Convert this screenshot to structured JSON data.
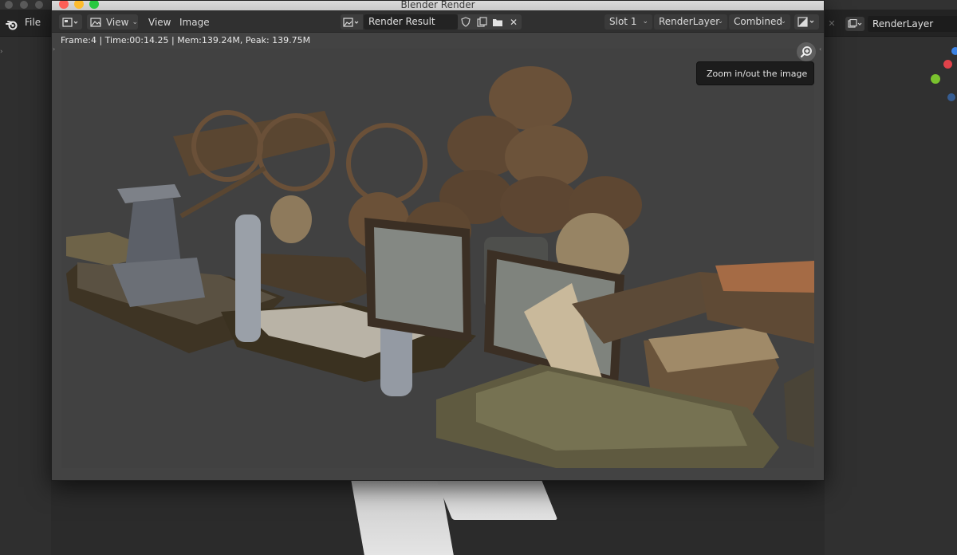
{
  "main_window": {
    "menu_file": "File",
    "render_layer_field": "RenderLayer",
    "icons": {
      "logo": "blender-logo-icon",
      "scene": "scene-icon",
      "close": "close-icon"
    }
  },
  "render_window": {
    "title": "Blender Render",
    "header": {
      "editor_type_icon": "image-editor-icon",
      "view_menu_dropdown": "View",
      "view_menu": "View",
      "image_menu": "Image",
      "image_name": "Render Result",
      "slot": "Slot 1",
      "layer": "RenderLayer",
      "pass": "Combined"
    },
    "frame_info": "Frame:4 | Time:00:14.25 | Mem:139.24M, Peak: 139.75M",
    "tooltip": "Zoom in/out the image"
  },
  "colors": {
    "axis_x": "#e0424a",
    "axis_y": "#7ac22e",
    "axis_z": "#3b82e4",
    "traffic_close": "#fd5f57",
    "traffic_min": "#febc2e",
    "traffic_max": "#28c840"
  }
}
